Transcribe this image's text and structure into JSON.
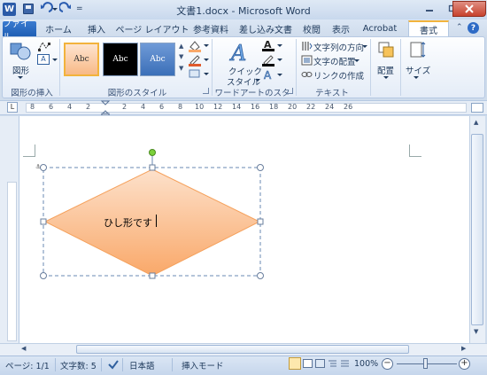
{
  "window": {
    "title": "文書1.docx - Microsoft Word",
    "app_icon": "W"
  },
  "tabs": [
    {
      "label": "ファイル"
    },
    {
      "label": "ホーム"
    },
    {
      "label": "挿入"
    },
    {
      "label": "ページ レイアウト"
    },
    {
      "label": "参考資料"
    },
    {
      "label": "差し込み文書"
    },
    {
      "label": "校閲"
    },
    {
      "label": "表示"
    },
    {
      "label": "Acrobat"
    },
    {
      "label": "書式",
      "active": true
    }
  ],
  "ribbon": {
    "insert_shapes": {
      "shapes_label": "図形",
      "group_label": "図形の挿入"
    },
    "shape_styles": {
      "style_samples": [
        "Abc",
        "Abc",
        "Abc"
      ],
      "group_label": "図形のスタイル"
    },
    "wordart": {
      "quick_styles_label_1": "クイック",
      "quick_styles_label_2": "スタイル",
      "group_label": "ワードアートのスタイル"
    },
    "text": {
      "direction_label": "文字列の方向",
      "align_label": "文字の配置",
      "link_label": "リンクの作成",
      "group_label": "テキスト"
    },
    "arrange": {
      "label": "配置"
    },
    "size": {
      "label": "サイズ"
    }
  },
  "ruler": {
    "marks": [
      "8",
      "6",
      "4",
      "2",
      "2",
      "4",
      "6",
      "8",
      "10",
      "12",
      "14",
      "16",
      "18",
      "20",
      "22",
      "24",
      "26"
    ]
  },
  "document": {
    "shape_text": "ひし形です"
  },
  "status": {
    "page": "ページ: 1/1",
    "words": "文字数: 5",
    "language": "日本語",
    "mode": "挿入モード",
    "zoom": "100%"
  },
  "colors": {
    "shape_fill_top": "#fde1cb",
    "shape_fill_bottom": "#f9a869",
    "accent_tab": "#f2b33c",
    "file_tab": "#2a6bc4"
  }
}
